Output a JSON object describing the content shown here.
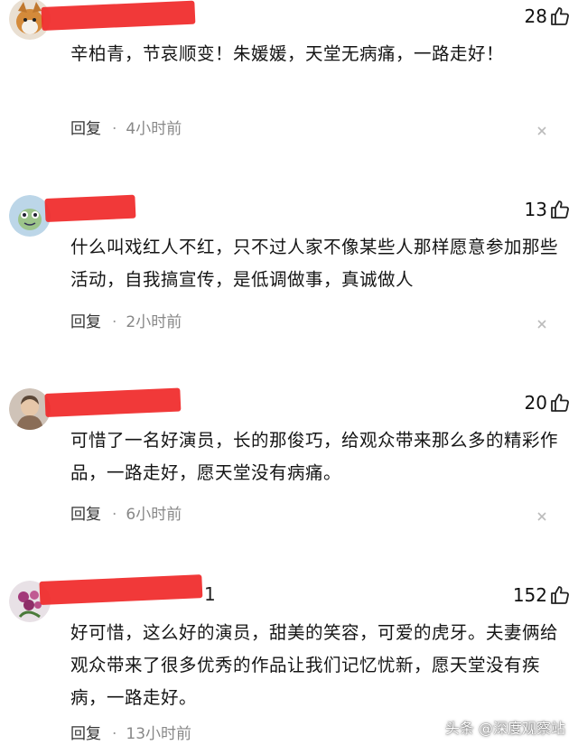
{
  "comments": [
    {
      "name_tail": "",
      "likes": "28",
      "text": "辛柏青，节哀顺变！朱媛媛，天堂无病痛，一路走好！",
      "reply_label": "回复",
      "time": "4小时前"
    },
    {
      "name_tail": "",
      "likes": "13",
      "text": "什么叫戏红人不红，只不过人家不像某些人那样愿意参加那些活动，自我搞宣传，是低调做事，真诚做人",
      "reply_label": "回复",
      "time": "2小时前"
    },
    {
      "name_tail": "",
      "likes": "20",
      "text": "可惜了一名好演员，长的那俊巧，给观众带来那么多的精彩作品，一路走好，愿天堂没有病痛。",
      "reply_label": "回复",
      "time": "6小时前"
    },
    {
      "name_tail": "1",
      "likes": "152",
      "text": "好可惜，这么好的演员，甜美的笑容，可爱的虎牙。夫妻俩给观众带来了很多优秀的作品让我们记忆忧新，愿天堂没有疾病，一路走好。",
      "reply_label": "回复",
      "time": "13小时前"
    }
  ],
  "watermark": "头条 @深度观察站",
  "colors": {
    "redaction": "#f02828",
    "text": "#151515",
    "meta": "#888888"
  },
  "icons": {
    "like": "thumbs-up-icon",
    "close": "close-icon"
  }
}
